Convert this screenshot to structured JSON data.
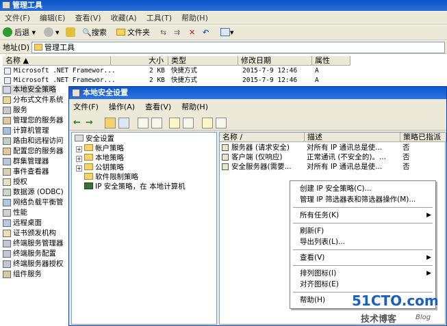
{
  "explorer": {
    "title": "管理工具",
    "menu": [
      "文件(F)",
      "编辑(E)",
      "查看(V)",
      "收藏(A)",
      "工具(T)",
      "帮助(H)"
    ],
    "toolbar": {
      "back": "后退",
      "search": "搜索",
      "folders": "文件夹"
    },
    "address_label": "地址(D)",
    "address_value": "管理工具",
    "columns": [
      "名称",
      "大小",
      "类型",
      "修改日期",
      "属性"
    ],
    "rows": [
      {
        "name": "Microsoft .NET Framewor...",
        "size": "2 KB",
        "type": "快捷方式",
        "date": "2015-7-9 12:46",
        "attr": "A"
      },
      {
        "name": "Microsoft .NET Framewor...",
        "size": "2 KB",
        "type": "快捷方式",
        "date": "2015-7-9 12:46",
        "attr": "A"
      }
    ],
    "left_items": [
      "本地安全策略",
      "分布式文件系统",
      "服务",
      "管理您的服务器",
      "计算机管理",
      "路由和远程访问",
      "配置您的服务器",
      "群集管理器",
      "事件查看器",
      "授权",
      "数据源 (ODBC)",
      "网络负载平衡管",
      "性能",
      "远程桌面",
      "证书颁发机构",
      "终端服务管理器",
      "终端服务配置",
      "终端服务器授权",
      "组件服务"
    ]
  },
  "mmc": {
    "title": "本地安全设置",
    "menu": [
      "文件(F)",
      "操作(A)",
      "查看(V)",
      "帮助(H)"
    ],
    "tree": [
      {
        "label": "安全设置",
        "level": 0
      },
      {
        "label": "帐户策略",
        "level": 1
      },
      {
        "label": "本地策略",
        "level": 1
      },
      {
        "label": "公钥策略",
        "level": 1
      },
      {
        "label": "软件限制策略",
        "level": 1
      },
      {
        "label": "IP 安全策略，在 本地计算机",
        "level": 1
      }
    ],
    "list_columns": [
      "名称",
      "描述",
      "策略已指派"
    ],
    "list_rows": [
      {
        "name": "服务器 (请求安全)",
        "desc": "对所有 IP 通讯总是使...",
        "assigned": "否"
      },
      {
        "name": "客户端 (仅响应)",
        "desc": "正常通讯 (不安全的)。...",
        "assigned": "否"
      },
      {
        "name": "安全服务器(需要...",
        "desc": "对所有 IP 通讯总是使...",
        "assigned": "否"
      }
    ]
  },
  "context_menu": {
    "items": [
      {
        "label": "创建 IP 安全策略(C)...",
        "submenu": false
      },
      {
        "label": "管理 IP 筛选器表和筛选器操作(M)...",
        "submenu": false
      },
      {
        "label": "所有任务(K)",
        "submenu": true
      },
      {
        "label": "刷新(F)",
        "submenu": false
      },
      {
        "label": "导出列表(L)...",
        "submenu": false
      },
      {
        "label": "查看(V)",
        "submenu": true
      },
      {
        "label": "排列图标(I)",
        "submenu": true
      },
      {
        "label": "对齐图标(E)",
        "submenu": false
      },
      {
        "label": "帮助(H)",
        "submenu": false
      }
    ]
  },
  "watermark": {
    "site": "51CTO.com",
    "sub": "技术博客",
    "blog": "Blog"
  }
}
